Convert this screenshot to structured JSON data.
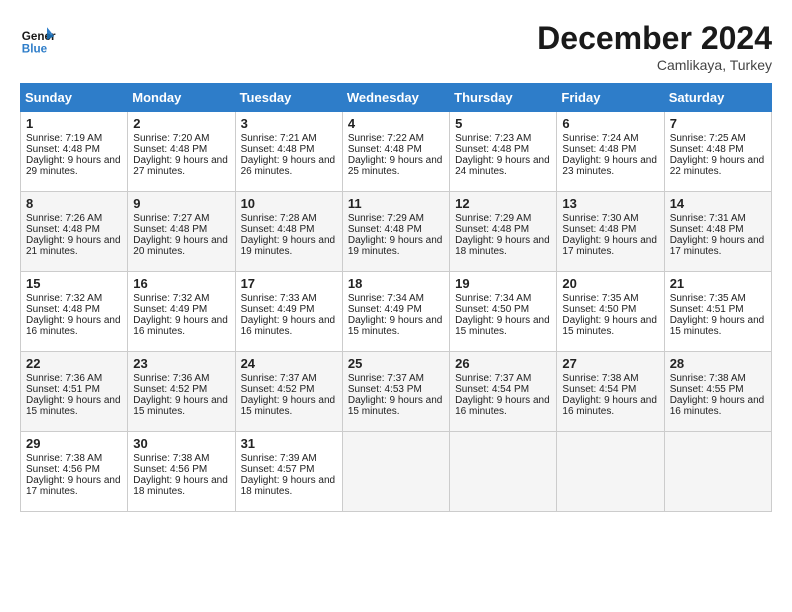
{
  "header": {
    "logo_line1": "General",
    "logo_line2": "Blue",
    "month": "December 2024",
    "location": "Camlikaya, Turkey"
  },
  "columns": [
    "Sunday",
    "Monday",
    "Tuesday",
    "Wednesday",
    "Thursday",
    "Friday",
    "Saturday"
  ],
  "weeks": [
    [
      {
        "day": "1",
        "sr": "Sunrise: 7:19 AM",
        "ss": "Sunset: 4:48 PM",
        "dl": "Daylight: 9 hours and 29 minutes."
      },
      {
        "day": "2",
        "sr": "Sunrise: 7:20 AM",
        "ss": "Sunset: 4:48 PM",
        "dl": "Daylight: 9 hours and 27 minutes."
      },
      {
        "day": "3",
        "sr": "Sunrise: 7:21 AM",
        "ss": "Sunset: 4:48 PM",
        "dl": "Daylight: 9 hours and 26 minutes."
      },
      {
        "day": "4",
        "sr": "Sunrise: 7:22 AM",
        "ss": "Sunset: 4:48 PM",
        "dl": "Daylight: 9 hours and 25 minutes."
      },
      {
        "day": "5",
        "sr": "Sunrise: 7:23 AM",
        "ss": "Sunset: 4:48 PM",
        "dl": "Daylight: 9 hours and 24 minutes."
      },
      {
        "day": "6",
        "sr": "Sunrise: 7:24 AM",
        "ss": "Sunset: 4:48 PM",
        "dl": "Daylight: 9 hours and 23 minutes."
      },
      {
        "day": "7",
        "sr": "Sunrise: 7:25 AM",
        "ss": "Sunset: 4:48 PM",
        "dl": "Daylight: 9 hours and 22 minutes."
      }
    ],
    [
      {
        "day": "8",
        "sr": "Sunrise: 7:26 AM",
        "ss": "Sunset: 4:48 PM",
        "dl": "Daylight: 9 hours and 21 minutes."
      },
      {
        "day": "9",
        "sr": "Sunrise: 7:27 AM",
        "ss": "Sunset: 4:48 PM",
        "dl": "Daylight: 9 hours and 20 minutes."
      },
      {
        "day": "10",
        "sr": "Sunrise: 7:28 AM",
        "ss": "Sunset: 4:48 PM",
        "dl": "Daylight: 9 hours and 19 minutes."
      },
      {
        "day": "11",
        "sr": "Sunrise: 7:29 AM",
        "ss": "Sunset: 4:48 PM",
        "dl": "Daylight: 9 hours and 19 minutes."
      },
      {
        "day": "12",
        "sr": "Sunrise: 7:29 AM",
        "ss": "Sunset: 4:48 PM",
        "dl": "Daylight: 9 hours and 18 minutes."
      },
      {
        "day": "13",
        "sr": "Sunrise: 7:30 AM",
        "ss": "Sunset: 4:48 PM",
        "dl": "Daylight: 9 hours and 17 minutes."
      },
      {
        "day": "14",
        "sr": "Sunrise: 7:31 AM",
        "ss": "Sunset: 4:48 PM",
        "dl": "Daylight: 9 hours and 17 minutes."
      }
    ],
    [
      {
        "day": "15",
        "sr": "Sunrise: 7:32 AM",
        "ss": "Sunset: 4:48 PM",
        "dl": "Daylight: 9 hours and 16 minutes."
      },
      {
        "day": "16",
        "sr": "Sunrise: 7:32 AM",
        "ss": "Sunset: 4:49 PM",
        "dl": "Daylight: 9 hours and 16 minutes."
      },
      {
        "day": "17",
        "sr": "Sunrise: 7:33 AM",
        "ss": "Sunset: 4:49 PM",
        "dl": "Daylight: 9 hours and 16 minutes."
      },
      {
        "day": "18",
        "sr": "Sunrise: 7:34 AM",
        "ss": "Sunset: 4:49 PM",
        "dl": "Daylight: 9 hours and 15 minutes."
      },
      {
        "day": "19",
        "sr": "Sunrise: 7:34 AM",
        "ss": "Sunset: 4:50 PM",
        "dl": "Daylight: 9 hours and 15 minutes."
      },
      {
        "day": "20",
        "sr": "Sunrise: 7:35 AM",
        "ss": "Sunset: 4:50 PM",
        "dl": "Daylight: 9 hours and 15 minutes."
      },
      {
        "day": "21",
        "sr": "Sunrise: 7:35 AM",
        "ss": "Sunset: 4:51 PM",
        "dl": "Daylight: 9 hours and 15 minutes."
      }
    ],
    [
      {
        "day": "22",
        "sr": "Sunrise: 7:36 AM",
        "ss": "Sunset: 4:51 PM",
        "dl": "Daylight: 9 hours and 15 minutes."
      },
      {
        "day": "23",
        "sr": "Sunrise: 7:36 AM",
        "ss": "Sunset: 4:52 PM",
        "dl": "Daylight: 9 hours and 15 minutes."
      },
      {
        "day": "24",
        "sr": "Sunrise: 7:37 AM",
        "ss": "Sunset: 4:52 PM",
        "dl": "Daylight: 9 hours and 15 minutes."
      },
      {
        "day": "25",
        "sr": "Sunrise: 7:37 AM",
        "ss": "Sunset: 4:53 PM",
        "dl": "Daylight: 9 hours and 15 minutes."
      },
      {
        "day": "26",
        "sr": "Sunrise: 7:37 AM",
        "ss": "Sunset: 4:54 PM",
        "dl": "Daylight: 9 hours and 16 minutes."
      },
      {
        "day": "27",
        "sr": "Sunrise: 7:38 AM",
        "ss": "Sunset: 4:54 PM",
        "dl": "Daylight: 9 hours and 16 minutes."
      },
      {
        "day": "28",
        "sr": "Sunrise: 7:38 AM",
        "ss": "Sunset: 4:55 PM",
        "dl": "Daylight: 9 hours and 16 minutes."
      }
    ],
    [
      {
        "day": "29",
        "sr": "Sunrise: 7:38 AM",
        "ss": "Sunset: 4:56 PM",
        "dl": "Daylight: 9 hours and 17 minutes."
      },
      {
        "day": "30",
        "sr": "Sunrise: 7:38 AM",
        "ss": "Sunset: 4:56 PM",
        "dl": "Daylight: 9 hours and 18 minutes."
      },
      {
        "day": "31",
        "sr": "Sunrise: 7:39 AM",
        "ss": "Sunset: 4:57 PM",
        "dl": "Daylight: 9 hours and 18 minutes."
      },
      null,
      null,
      null,
      null
    ]
  ]
}
